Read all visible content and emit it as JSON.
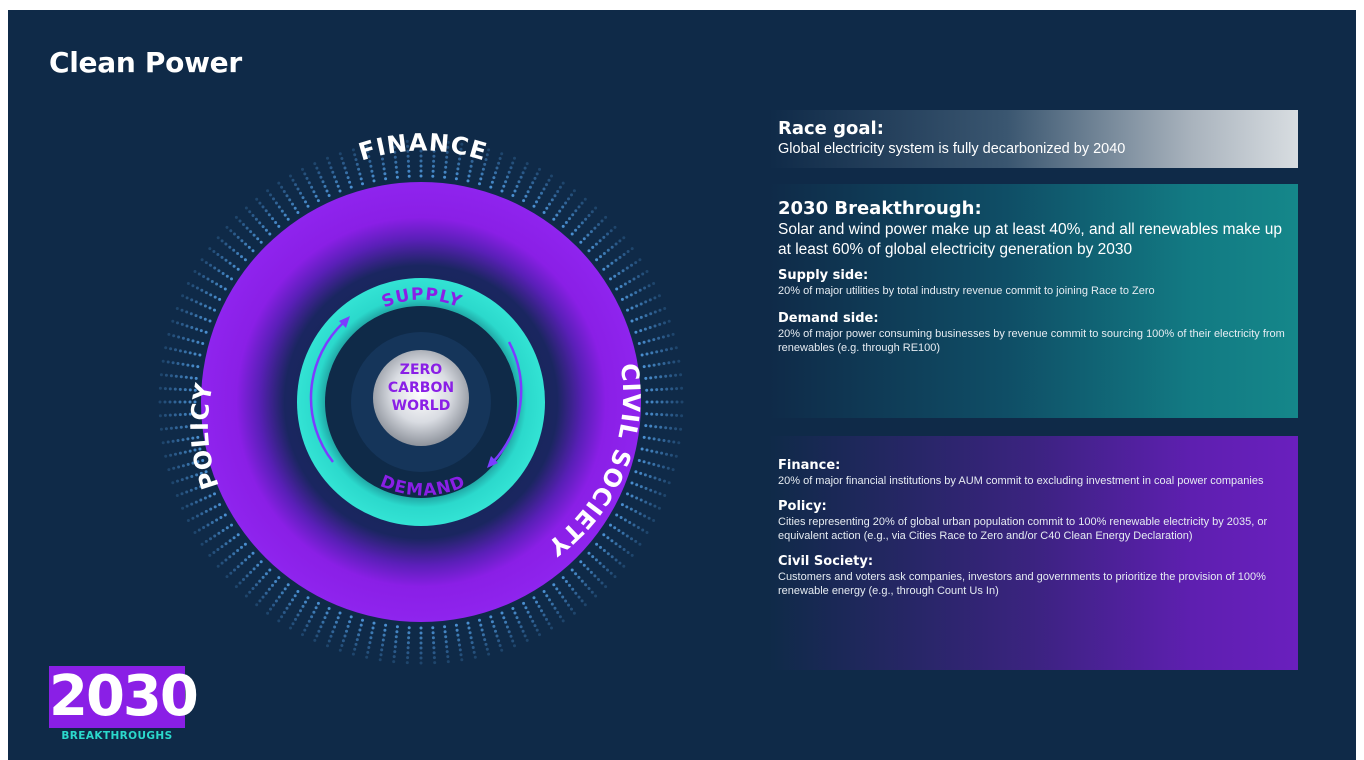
{
  "title": "Clean Power",
  "diagram": {
    "outer_ring_labels": {
      "top": "FINANCE",
      "left": "POLICY",
      "right": "CIVIL SOCIETY"
    },
    "inner_ring_labels": {
      "top": "SUPPLY",
      "bottom": "DEMAND"
    },
    "center_text": [
      "ZERO",
      "CARBON",
      "WORLD"
    ],
    "colors": {
      "outer_ring": "#8a1fe6",
      "inner_ring": "#2bd9cc",
      "dots": "#4a8fd0",
      "background": "#0f2a48"
    }
  },
  "logo": {
    "number": "2030",
    "subtitle": "BREAKTHROUGHS"
  },
  "race_goal": {
    "heading": "Race goal:",
    "text": "Global electricity system is fully decarbonized by 2040"
  },
  "breakthrough": {
    "heading": "2030 Breakthrough:",
    "text": "Solar and wind power make up at least 40%, and all renewables make up at least 60% of global electricity generation by 2030",
    "supply_heading": "Supply side:",
    "supply_text": "20% of major utilities by total industry revenue commit to joining Race to Zero",
    "demand_heading": "Demand side:",
    "demand_text": "20% of major power consuming businesses by revenue commit to sourcing 100% of their electricity from renewables (e.g. through RE100)"
  },
  "levers": {
    "finance_heading": "Finance:",
    "finance_text": "20% of major financial institutions by AUM commit to excluding investment in coal power companies",
    "policy_heading": "Policy:",
    "policy_text": "Cities representing 20% of global urban population commit to 100% renewable electricity by 2035, or equivalent action (e.g., via Cities Race to Zero and/or C40 Clean Energy Declaration)",
    "civil_heading": "Civil Society:",
    "civil_text": "Customers and voters ask companies, investors and governments to prioritize the provision of 100% renewable energy (e.g., through Count Us In)"
  }
}
